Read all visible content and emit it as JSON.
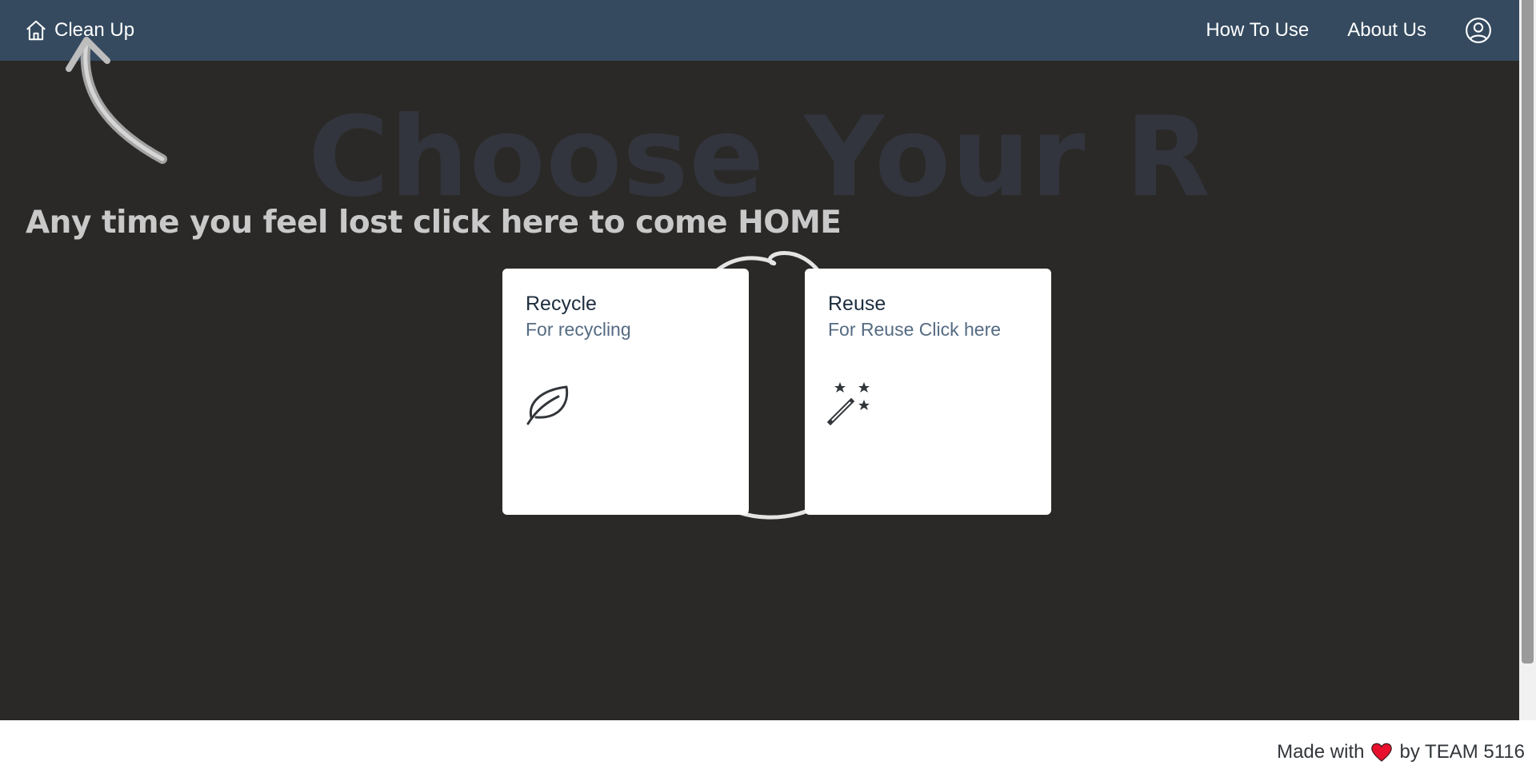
{
  "header": {
    "home_label": "Clean Up",
    "nav": [
      "How To Use",
      "About Us"
    ],
    "icons": {
      "home": "home-icon",
      "profile": "user-circle-icon"
    }
  },
  "main": {
    "background_title": "Choose Your R",
    "hint": "Any time you feel lost click here to come HOME",
    "cards": [
      {
        "title": "Recycle",
        "subtitle": "For recycling",
        "icon": "leaf-icon"
      },
      {
        "title": "Reuse",
        "subtitle": "For Reuse Click here",
        "icon": "magic-wand-icon"
      }
    ]
  },
  "footer": {
    "prefix": "Made with",
    "suffix": "by TEAM 5116",
    "icon": "heart-icon"
  },
  "colors": {
    "header_bg": "#354a5f",
    "main_bg": "#2a2927",
    "card_bg": "#ffffff",
    "heart": "#e8112d"
  }
}
